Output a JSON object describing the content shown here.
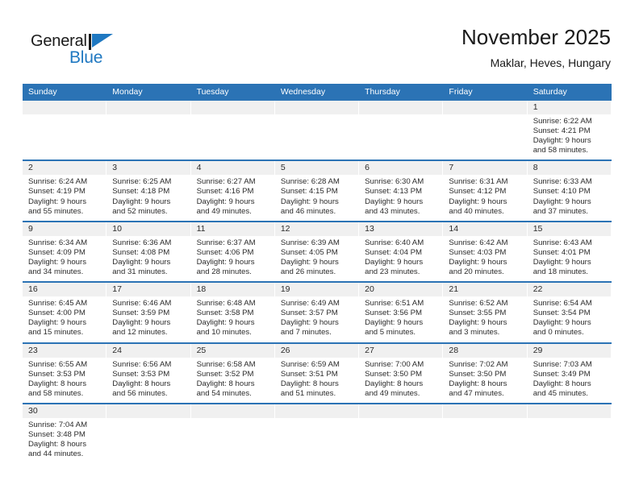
{
  "brand": {
    "name_part1": "General",
    "name_part2": "Blue",
    "flag_icon": "triangle-flag-icon",
    "color_primary": "#1f78c1"
  },
  "header": {
    "title": "November 2025",
    "subtitle": "Maklar, Heves, Hungary"
  },
  "theme": {
    "header_blue": "#2b73b5",
    "day_band_gray": "#f0f0f0",
    "text_dark": "#2b2b2b"
  },
  "weekdays": [
    "Sunday",
    "Monday",
    "Tuesday",
    "Wednesday",
    "Thursday",
    "Friday",
    "Saturday"
  ],
  "weeks": [
    {
      "days": [
        {
          "empty": true
        },
        {
          "empty": true
        },
        {
          "empty": true
        },
        {
          "empty": true
        },
        {
          "empty": true
        },
        {
          "empty": true
        },
        {
          "num": "1",
          "sunrise": "Sunrise: 6:22 AM",
          "sunset": "Sunset: 4:21 PM",
          "daylight1": "Daylight: 9 hours",
          "daylight2": "and 58 minutes."
        }
      ]
    },
    {
      "days": [
        {
          "num": "2",
          "sunrise": "Sunrise: 6:24 AM",
          "sunset": "Sunset: 4:19 PM",
          "daylight1": "Daylight: 9 hours",
          "daylight2": "and 55 minutes."
        },
        {
          "num": "3",
          "sunrise": "Sunrise: 6:25 AM",
          "sunset": "Sunset: 4:18 PM",
          "daylight1": "Daylight: 9 hours",
          "daylight2": "and 52 minutes."
        },
        {
          "num": "4",
          "sunrise": "Sunrise: 6:27 AM",
          "sunset": "Sunset: 4:16 PM",
          "daylight1": "Daylight: 9 hours",
          "daylight2": "and 49 minutes."
        },
        {
          "num": "5",
          "sunrise": "Sunrise: 6:28 AM",
          "sunset": "Sunset: 4:15 PM",
          "daylight1": "Daylight: 9 hours",
          "daylight2": "and 46 minutes."
        },
        {
          "num": "6",
          "sunrise": "Sunrise: 6:30 AM",
          "sunset": "Sunset: 4:13 PM",
          "daylight1": "Daylight: 9 hours",
          "daylight2": "and 43 minutes."
        },
        {
          "num": "7",
          "sunrise": "Sunrise: 6:31 AM",
          "sunset": "Sunset: 4:12 PM",
          "daylight1": "Daylight: 9 hours",
          "daylight2": "and 40 minutes."
        },
        {
          "num": "8",
          "sunrise": "Sunrise: 6:33 AM",
          "sunset": "Sunset: 4:10 PM",
          "daylight1": "Daylight: 9 hours",
          "daylight2": "and 37 minutes."
        }
      ]
    },
    {
      "days": [
        {
          "num": "9",
          "sunrise": "Sunrise: 6:34 AM",
          "sunset": "Sunset: 4:09 PM",
          "daylight1": "Daylight: 9 hours",
          "daylight2": "and 34 minutes."
        },
        {
          "num": "10",
          "sunrise": "Sunrise: 6:36 AM",
          "sunset": "Sunset: 4:08 PM",
          "daylight1": "Daylight: 9 hours",
          "daylight2": "and 31 minutes."
        },
        {
          "num": "11",
          "sunrise": "Sunrise: 6:37 AM",
          "sunset": "Sunset: 4:06 PM",
          "daylight1": "Daylight: 9 hours",
          "daylight2": "and 28 minutes."
        },
        {
          "num": "12",
          "sunrise": "Sunrise: 6:39 AM",
          "sunset": "Sunset: 4:05 PM",
          "daylight1": "Daylight: 9 hours",
          "daylight2": "and 26 minutes."
        },
        {
          "num": "13",
          "sunrise": "Sunrise: 6:40 AM",
          "sunset": "Sunset: 4:04 PM",
          "daylight1": "Daylight: 9 hours",
          "daylight2": "and 23 minutes."
        },
        {
          "num": "14",
          "sunrise": "Sunrise: 6:42 AM",
          "sunset": "Sunset: 4:03 PM",
          "daylight1": "Daylight: 9 hours",
          "daylight2": "and 20 minutes."
        },
        {
          "num": "15",
          "sunrise": "Sunrise: 6:43 AM",
          "sunset": "Sunset: 4:01 PM",
          "daylight1": "Daylight: 9 hours",
          "daylight2": "and 18 minutes."
        }
      ]
    },
    {
      "days": [
        {
          "num": "16",
          "sunrise": "Sunrise: 6:45 AM",
          "sunset": "Sunset: 4:00 PM",
          "daylight1": "Daylight: 9 hours",
          "daylight2": "and 15 minutes."
        },
        {
          "num": "17",
          "sunrise": "Sunrise: 6:46 AM",
          "sunset": "Sunset: 3:59 PM",
          "daylight1": "Daylight: 9 hours",
          "daylight2": "and 12 minutes."
        },
        {
          "num": "18",
          "sunrise": "Sunrise: 6:48 AM",
          "sunset": "Sunset: 3:58 PM",
          "daylight1": "Daylight: 9 hours",
          "daylight2": "and 10 minutes."
        },
        {
          "num": "19",
          "sunrise": "Sunrise: 6:49 AM",
          "sunset": "Sunset: 3:57 PM",
          "daylight1": "Daylight: 9 hours",
          "daylight2": "and 7 minutes."
        },
        {
          "num": "20",
          "sunrise": "Sunrise: 6:51 AM",
          "sunset": "Sunset: 3:56 PM",
          "daylight1": "Daylight: 9 hours",
          "daylight2": "and 5 minutes."
        },
        {
          "num": "21",
          "sunrise": "Sunrise: 6:52 AM",
          "sunset": "Sunset: 3:55 PM",
          "daylight1": "Daylight: 9 hours",
          "daylight2": "and 3 minutes."
        },
        {
          "num": "22",
          "sunrise": "Sunrise: 6:54 AM",
          "sunset": "Sunset: 3:54 PM",
          "daylight1": "Daylight: 9 hours",
          "daylight2": "and 0 minutes."
        }
      ]
    },
    {
      "days": [
        {
          "num": "23",
          "sunrise": "Sunrise: 6:55 AM",
          "sunset": "Sunset: 3:53 PM",
          "daylight1": "Daylight: 8 hours",
          "daylight2": "and 58 minutes."
        },
        {
          "num": "24",
          "sunrise": "Sunrise: 6:56 AM",
          "sunset": "Sunset: 3:53 PM",
          "daylight1": "Daylight: 8 hours",
          "daylight2": "and 56 minutes."
        },
        {
          "num": "25",
          "sunrise": "Sunrise: 6:58 AM",
          "sunset": "Sunset: 3:52 PM",
          "daylight1": "Daylight: 8 hours",
          "daylight2": "and 54 minutes."
        },
        {
          "num": "26",
          "sunrise": "Sunrise: 6:59 AM",
          "sunset": "Sunset: 3:51 PM",
          "daylight1": "Daylight: 8 hours",
          "daylight2": "and 51 minutes."
        },
        {
          "num": "27",
          "sunrise": "Sunrise: 7:00 AM",
          "sunset": "Sunset: 3:50 PM",
          "daylight1": "Daylight: 8 hours",
          "daylight2": "and 49 minutes."
        },
        {
          "num": "28",
          "sunrise": "Sunrise: 7:02 AM",
          "sunset": "Sunset: 3:50 PM",
          "daylight1": "Daylight: 8 hours",
          "daylight2": "and 47 minutes."
        },
        {
          "num": "29",
          "sunrise": "Sunrise: 7:03 AM",
          "sunset": "Sunset: 3:49 PM",
          "daylight1": "Daylight: 8 hours",
          "daylight2": "and 45 minutes."
        }
      ]
    },
    {
      "days": [
        {
          "num": "30",
          "sunrise": "Sunrise: 7:04 AM",
          "sunset": "Sunset: 3:48 PM",
          "daylight1": "Daylight: 8 hours",
          "daylight2": "and 44 minutes."
        },
        {
          "empty": true
        },
        {
          "empty": true
        },
        {
          "empty": true
        },
        {
          "empty": true
        },
        {
          "empty": true
        },
        {
          "empty": true
        }
      ]
    }
  ]
}
